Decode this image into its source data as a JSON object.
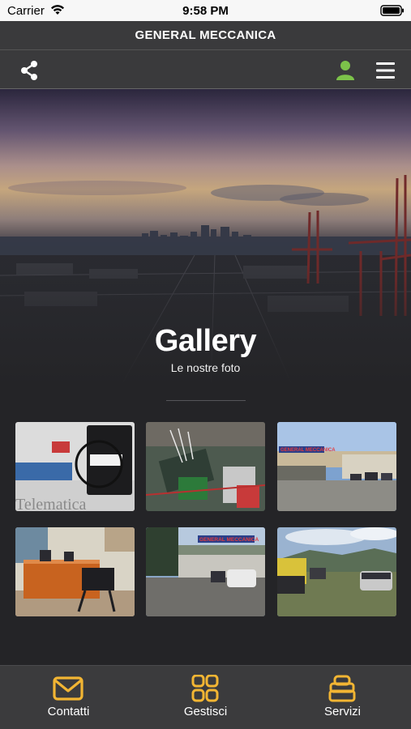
{
  "status_bar": {
    "carrier": "Carrier",
    "time": "9:58 PM"
  },
  "app": {
    "title": "GENERAL MECCANICA"
  },
  "toolbar": {
    "share_icon": "share-icon",
    "user_icon": "user-icon",
    "menu_icon": "hamburger-menu-icon",
    "user_color": "#7cc24a"
  },
  "hero": {
    "title": "Gallery",
    "subtitle": "Le nostre foto"
  },
  "gallery": {
    "photos": [
      {
        "icon": "photo-telematics-device",
        "caption": "Telematica"
      },
      {
        "icon": "photo-electronics-bench"
      },
      {
        "icon": "photo-workshop-exterior",
        "sign": "GENERAL MECCANICA"
      },
      {
        "icon": "photo-office-reception"
      },
      {
        "icon": "photo-workshop-yard",
        "sign": "GENERAL MECCANICA"
      },
      {
        "icon": "photo-parking-lot"
      }
    ]
  },
  "bottom_nav": {
    "accent": "#f2b533",
    "items": [
      {
        "label": "Contatti",
        "icon": "envelope-icon"
      },
      {
        "label": "Gestisci",
        "icon": "grid-icon"
      },
      {
        "label": "Servizi",
        "icon": "stack-icon"
      }
    ]
  }
}
